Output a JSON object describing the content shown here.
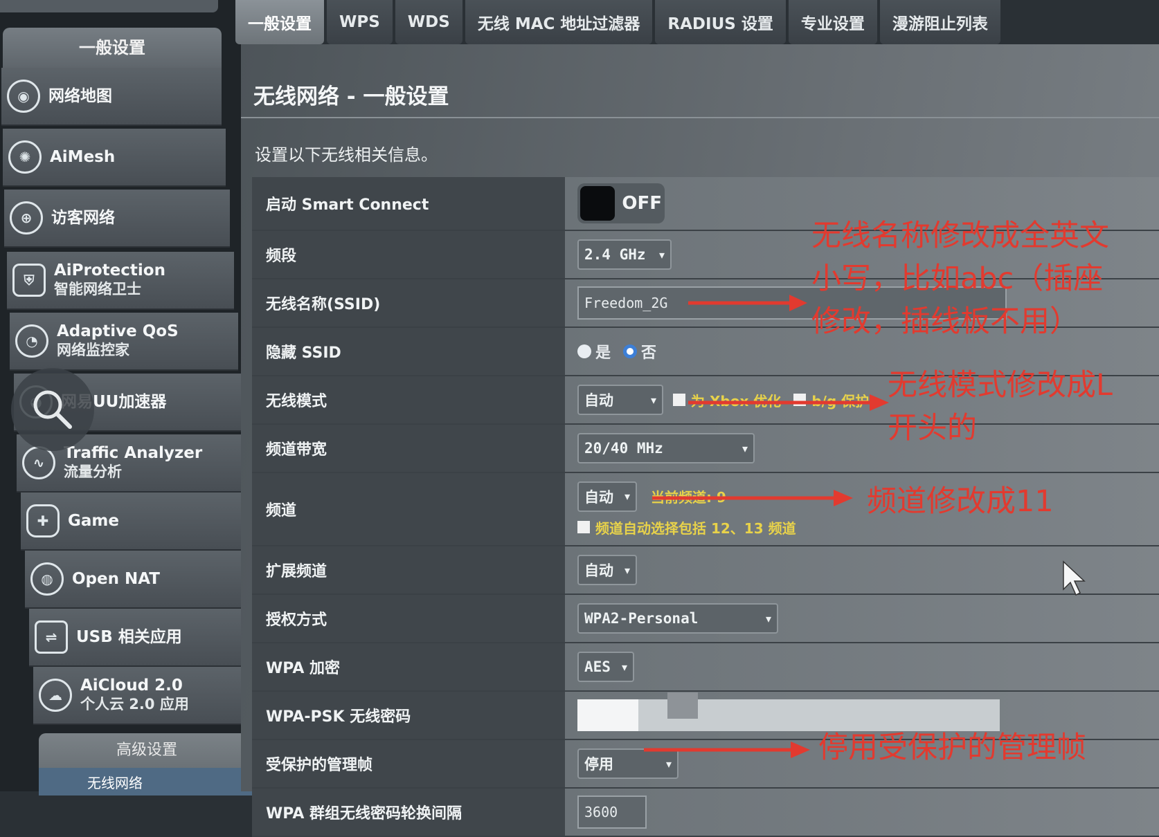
{
  "tabs": [
    {
      "label": "一般设置",
      "active": true
    },
    {
      "label": "WPS"
    },
    {
      "label": "WDS"
    },
    {
      "label": "无线 MAC 地址过滤器"
    },
    {
      "label": "RADIUS 设置"
    },
    {
      "label": "专业设置"
    },
    {
      "label": "漫游阻止列表"
    }
  ],
  "sidebar": {
    "header": "一般设置",
    "items": [
      {
        "label": "网络地图",
        "icon": "globe-pin-icon"
      },
      {
        "label": "AiMesh",
        "icon": "mesh-icon"
      },
      {
        "label": "访客网络",
        "icon": "guest-network-icon"
      },
      {
        "label": "AiProtection",
        "sub": "智能网络卫士",
        "icon": "shield-lock-icon"
      },
      {
        "label": "Adaptive QoS",
        "sub": "网络监控家",
        "icon": "gauge-icon"
      },
      {
        "label": "网易UU加速器",
        "icon": "speedometer-icon"
      },
      {
        "label": "Traffic Analyzer",
        "sub": "流量分析",
        "icon": "traffic-icon"
      },
      {
        "label": "Game",
        "icon": "gamepad-icon"
      },
      {
        "label": "Open NAT",
        "icon": "globe-gamer-icon"
      },
      {
        "label": "USB 相关应用",
        "icon": "usb-icon"
      },
      {
        "label": "AiCloud 2.0",
        "sub": "个人云 2.0 应用",
        "icon": "cloud-icon"
      }
    ],
    "advanced_header": "高级设置",
    "advanced_first_item": "无线网络"
  },
  "main": {
    "title": "无线网络 - 一般设置",
    "description": "设置以下无线相关信息。"
  },
  "settings": {
    "smart_connect": {
      "label": "启动 Smart Connect",
      "value": "OFF"
    },
    "band": {
      "label": "频段",
      "value": "2.4 GHz"
    },
    "ssid": {
      "label": "无线名称(SSID)",
      "value": "Freedom_2G"
    },
    "hide_ssid": {
      "label": "隐藏 SSID",
      "opt_yes": "是",
      "opt_no": "否",
      "selected": "否"
    },
    "wireless_mode": {
      "label": "无线模式",
      "value": "自动",
      "opt1": "为 Xbox 优化",
      "opt2": "b/g 保护"
    },
    "channel_bandwidth": {
      "label": "频道带宽",
      "value": "20/40 MHz"
    },
    "channel": {
      "label": "频道",
      "value": "自动",
      "current": "当前频道: 9",
      "auto_note": "频道自动选择包括 12、13 频道"
    },
    "ext_channel": {
      "label": "扩展频道",
      "value": "自动"
    },
    "auth_method": {
      "label": "授权方式",
      "value": "WPA2-Personal"
    },
    "wpa_encryption": {
      "label": "WPA 加密",
      "value": "AES"
    },
    "wpa_psk": {
      "label": "WPA-PSK 无线密码"
    },
    "pmf": {
      "label": "受保护的管理帧",
      "value": "停用"
    },
    "gtk_interval": {
      "label": "WPA 群组无线密码轮换间隔",
      "value": "3600"
    }
  },
  "annotations": {
    "ssid_line1": "无线名称修改成全英文",
    "ssid_line2": "小写，比如abc（插座",
    "ssid_line3": "修改，插线板不用）",
    "mode_line1": "无线模式修改成L",
    "mode_line2": "开头的",
    "channel": "频道修改成11",
    "pmf": "停用受保护的管理帧",
    "color": "#e23a2f"
  }
}
